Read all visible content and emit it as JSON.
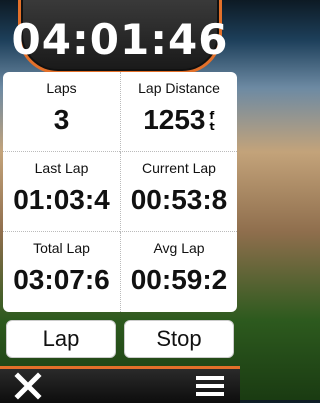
{
  "timer": {
    "value": "04:01:46"
  },
  "fields": [
    {
      "label": "Laps",
      "value": "3"
    },
    {
      "label": "Lap Distance",
      "value": "1253",
      "unit_top": "f",
      "unit_bottom": "t"
    },
    {
      "label": "Last Lap",
      "value": "01:03:4"
    },
    {
      "label": "Current Lap",
      "value": "00:53:8"
    },
    {
      "label": "Total Lap",
      "value": "03:07:6"
    },
    {
      "label": "Avg Lap",
      "value": "00:59:2"
    }
  ],
  "buttons": {
    "lap": "Lap",
    "stop": "Stop"
  },
  "icons": {
    "close": "close-icon",
    "menu": "menu-icon"
  },
  "colors": {
    "accent": "#e3702a",
    "bar": "#1a1a1a"
  }
}
